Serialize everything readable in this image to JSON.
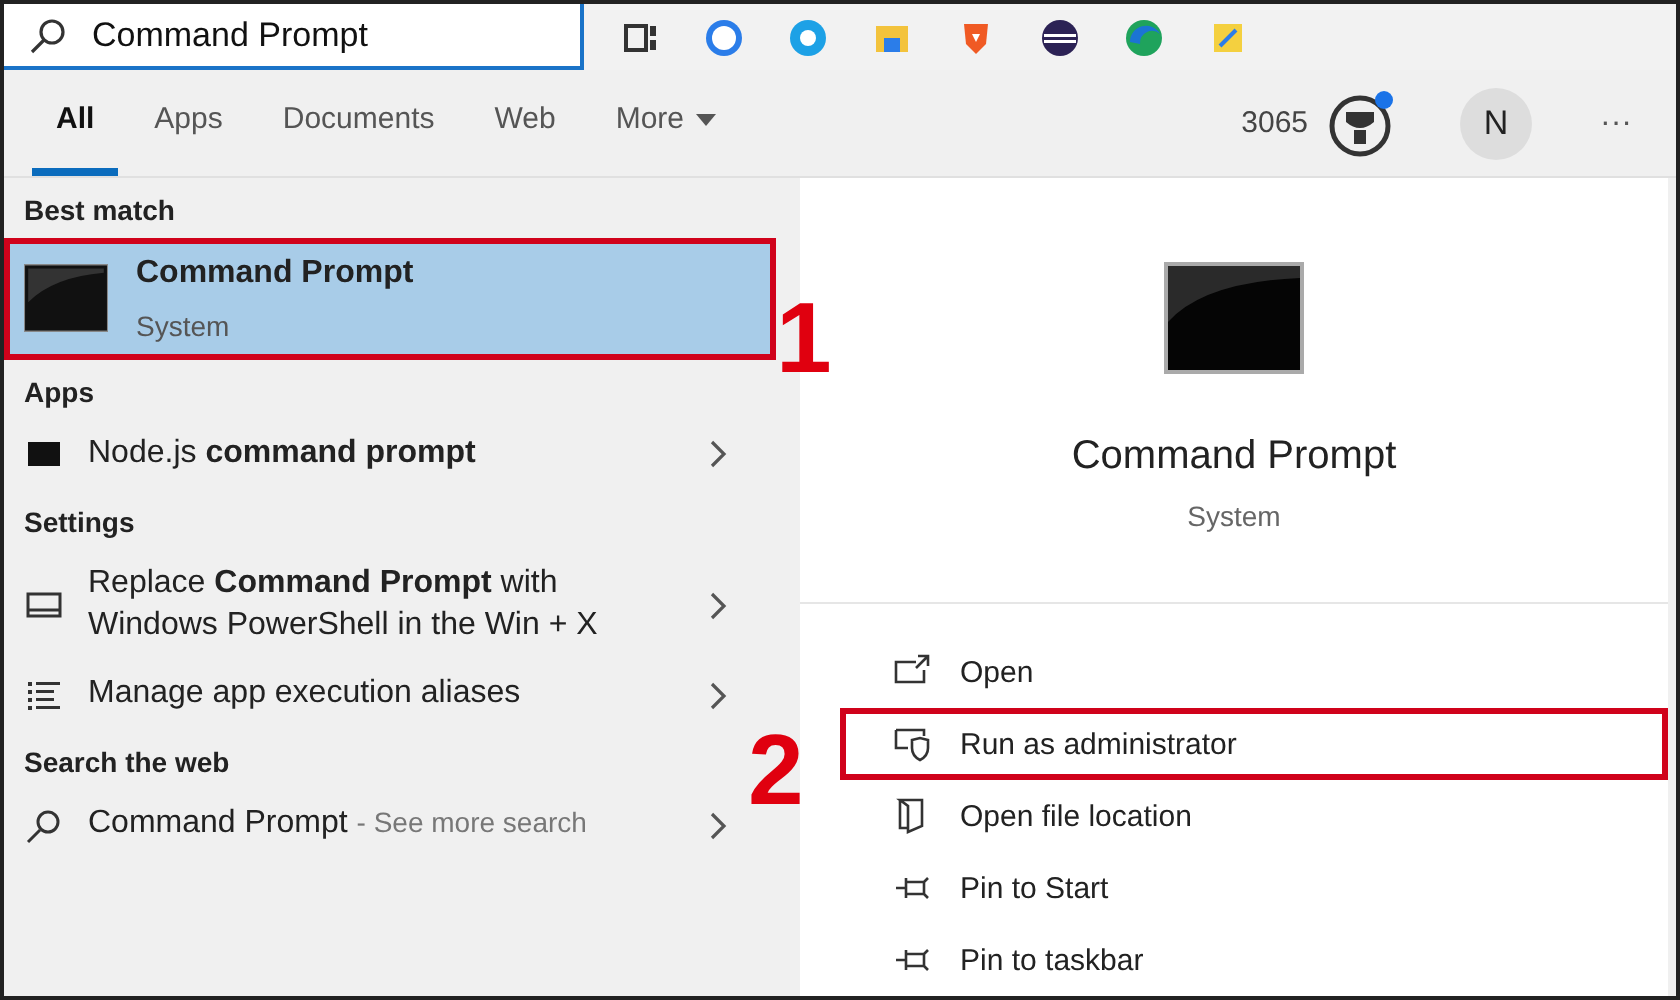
{
  "search": {
    "value": "Command Prompt"
  },
  "taskbar_icons": [
    {
      "kind": "layout"
    },
    {
      "kind": "chat"
    },
    {
      "kind": "call"
    },
    {
      "kind": "folder"
    },
    {
      "kind": "lion"
    },
    {
      "kind": "planet"
    },
    {
      "kind": "wave"
    },
    {
      "kind": "tool"
    }
  ],
  "tabs": [
    {
      "label": "All",
      "selected": true,
      "kind": "tab"
    },
    {
      "label": "Apps",
      "selected": false,
      "kind": "tab"
    },
    {
      "label": "Documents",
      "selected": false,
      "kind": "tab"
    },
    {
      "label": "Web",
      "selected": false,
      "kind": "tab"
    },
    {
      "label": "More",
      "selected": false,
      "kind": "menu"
    }
  ],
  "points": "3065",
  "avatar": "N",
  "more_menu": "···",
  "sections": [
    {
      "heading": "Best match",
      "items": [
        {
          "kind": "best",
          "title": "Command Prompt",
          "subtitle": "System",
          "selected": true,
          "callout": "1"
        }
      ]
    },
    {
      "heading": "Apps",
      "items": [
        {
          "kind": "app",
          "title": "Node.js **command prompt**",
          "selected": false
        }
      ]
    },
    {
      "heading": "Settings",
      "items": [
        {
          "kind": "display",
          "title": "Replace **Command Prompt** with Windows PowerShell in the Win + X",
          "selected": false
        },
        {
          "kind": "list",
          "title": "Manage app execution aliases",
          "selected": false
        }
      ]
    },
    {
      "heading": "Search the web",
      "items": [
        {
          "kind": "web",
          "title": "Command Prompt",
          "hint": "- See more search",
          "selected": false
        }
      ]
    }
  ],
  "detail": {
    "title": "Command Prompt",
    "subtitle": "System"
  },
  "actions": [
    {
      "kind": "open",
      "label": "Open",
      "highlighted": false
    },
    {
      "kind": "admin",
      "label": "Run as administrator",
      "highlighted": true,
      "callout": "2"
    },
    {
      "kind": "folder",
      "label": "Open file location",
      "highlighted": false
    },
    {
      "kind": "pin",
      "label": "Pin to Start",
      "highlighted": false
    },
    {
      "kind": "pin",
      "label": "Pin to taskbar",
      "highlighted": false
    }
  ]
}
